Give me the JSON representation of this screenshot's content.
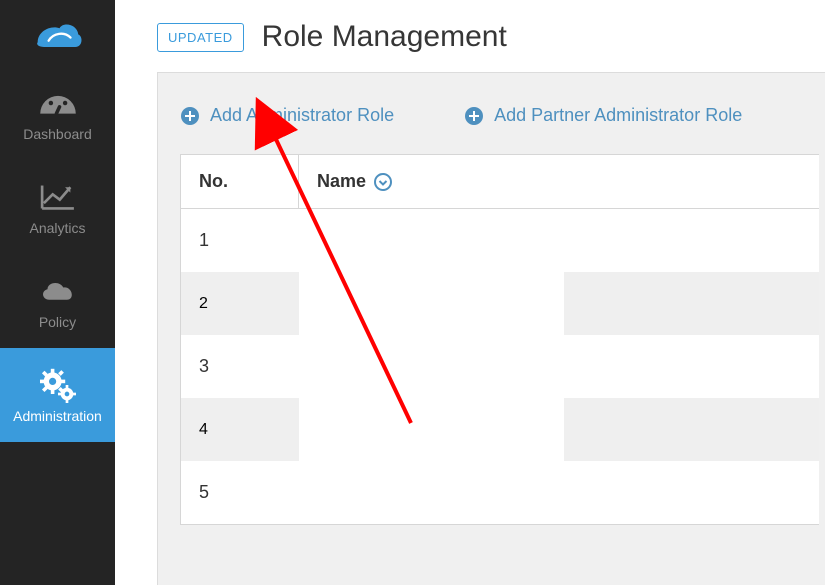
{
  "sidebar": {
    "items": [
      {
        "label": "Dashboard"
      },
      {
        "label": "Analytics"
      },
      {
        "label": "Policy"
      },
      {
        "label": "Administration"
      }
    ]
  },
  "header": {
    "badge": "UPDATED",
    "title": "Role Management"
  },
  "actions": {
    "add_admin": "Add Administrator Role",
    "add_partner": "Add Partner Administrator Role"
  },
  "table": {
    "columns": {
      "no": "No.",
      "name": "Name"
    },
    "rows": [
      {
        "no": "1"
      },
      {
        "no": "2"
      },
      {
        "no": "3"
      },
      {
        "no": "4"
      },
      {
        "no": "5"
      }
    ]
  },
  "colors": {
    "accent": "#3a9bdc",
    "link": "#4e90bf",
    "sidebar_bg": "#242424"
  }
}
